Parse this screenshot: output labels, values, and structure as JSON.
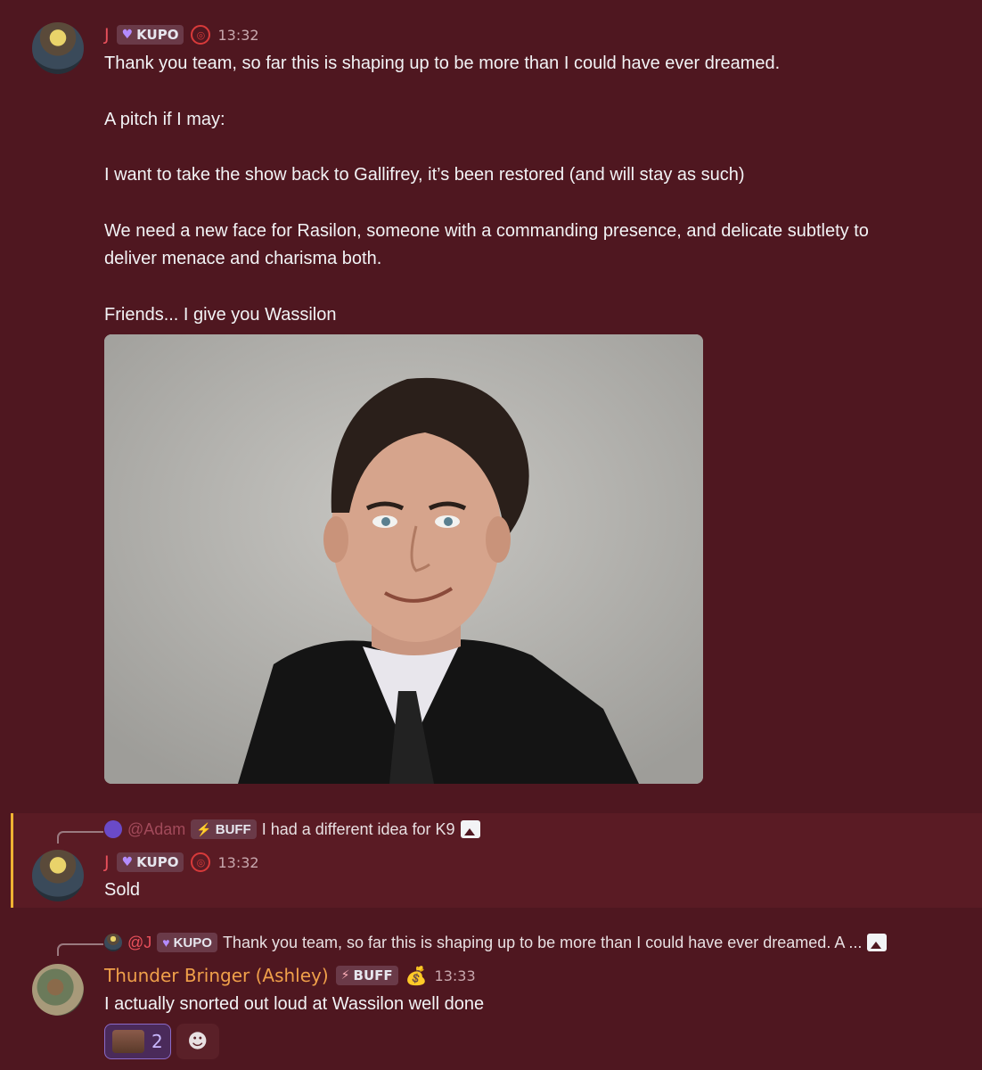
{
  "messages": [
    {
      "username": "J",
      "tag": "KUPO",
      "time": "13:32",
      "lines": [
        "Thank you team, so far this is shaping up to be more than I could have ever dreamed.",
        "A pitch if I may:",
        "I want to take the show back to Gallifrey, it’s been restored (and will stay as such)",
        "We need a new face for Rasilon, someone with a commanding presence, and delicate subtlety to",
        "deliver menace and charisma both.",
        "Friends... I give you Wassilon"
      ]
    },
    {
      "reply": {
        "mention": "@Adam",
        "tag": "BUFF",
        "text": "I had a different idea for K9"
      },
      "username": "J",
      "tag": "KUPO",
      "time": "13:32",
      "text": "Sold"
    },
    {
      "reply": {
        "mention": "@J",
        "tag": "KUPO",
        "text": "Thank you team, so far this is shaping up to be more than I could have ever dreamed.   A ..."
      },
      "username": "Thunder Bringer (Ashley)",
      "tag": "BUFF",
      "time": "13:33",
      "text": "I actually snorted out loud at Wassilon well done",
      "reaction_count": "2"
    }
  ]
}
